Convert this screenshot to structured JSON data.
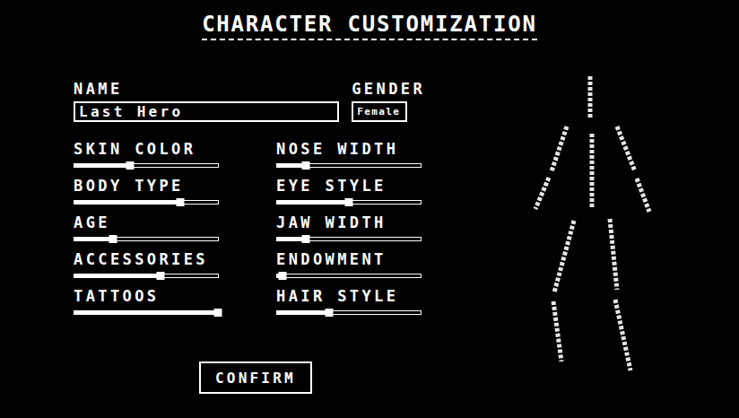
{
  "title": "CHARACTER CUSTOMIZATION",
  "name": {
    "label": "NAME",
    "value": "Last Hero"
  },
  "gender": {
    "label": "GENDER",
    "value": "Female"
  },
  "sliders": [
    {
      "label": "SKIN COLOR",
      "level": 0.39
    },
    {
      "label": "BODY TYPE",
      "level": 0.74
    },
    {
      "label": "AGE",
      "level": 0.27
    },
    {
      "label": "ACCESSORIES",
      "level": 0.6
    },
    {
      "label": "TATTOOS",
      "level": 1.0
    },
    {
      "label": "NOSE WIDTH",
      "level": 0.2
    },
    {
      "label": "EYE STYLE",
      "level": 0.5
    },
    {
      "label": "JAW WIDTH",
      "level": 0.2
    },
    {
      "label": "ENDOWMENT",
      "level": 0.04
    },
    {
      "label": "HAIR STYLE",
      "level": 0.36
    }
  ],
  "buttons": [
    "CONFIRM"
  ]
}
